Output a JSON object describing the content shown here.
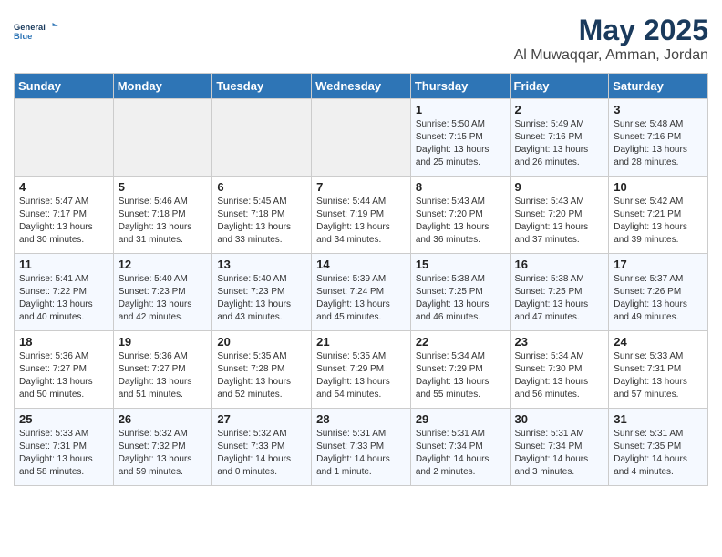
{
  "logo": {
    "line1": "General",
    "line2": "Blue"
  },
  "title": "May 2025",
  "location": "Al Muwaqqar, Amman, Jordan",
  "weekdays": [
    "Sunday",
    "Monday",
    "Tuesday",
    "Wednesday",
    "Thursday",
    "Friday",
    "Saturday"
  ],
  "weeks": [
    [
      {
        "day": "",
        "info": ""
      },
      {
        "day": "",
        "info": ""
      },
      {
        "day": "",
        "info": ""
      },
      {
        "day": "",
        "info": ""
      },
      {
        "day": "1",
        "info": "Sunrise: 5:50 AM\nSunset: 7:15 PM\nDaylight: 13 hours\nand 25 minutes."
      },
      {
        "day": "2",
        "info": "Sunrise: 5:49 AM\nSunset: 7:16 PM\nDaylight: 13 hours\nand 26 minutes."
      },
      {
        "day": "3",
        "info": "Sunrise: 5:48 AM\nSunset: 7:16 PM\nDaylight: 13 hours\nand 28 minutes."
      }
    ],
    [
      {
        "day": "4",
        "info": "Sunrise: 5:47 AM\nSunset: 7:17 PM\nDaylight: 13 hours\nand 30 minutes."
      },
      {
        "day": "5",
        "info": "Sunrise: 5:46 AM\nSunset: 7:18 PM\nDaylight: 13 hours\nand 31 minutes."
      },
      {
        "day": "6",
        "info": "Sunrise: 5:45 AM\nSunset: 7:18 PM\nDaylight: 13 hours\nand 33 minutes."
      },
      {
        "day": "7",
        "info": "Sunrise: 5:44 AM\nSunset: 7:19 PM\nDaylight: 13 hours\nand 34 minutes."
      },
      {
        "day": "8",
        "info": "Sunrise: 5:43 AM\nSunset: 7:20 PM\nDaylight: 13 hours\nand 36 minutes."
      },
      {
        "day": "9",
        "info": "Sunrise: 5:43 AM\nSunset: 7:20 PM\nDaylight: 13 hours\nand 37 minutes."
      },
      {
        "day": "10",
        "info": "Sunrise: 5:42 AM\nSunset: 7:21 PM\nDaylight: 13 hours\nand 39 minutes."
      }
    ],
    [
      {
        "day": "11",
        "info": "Sunrise: 5:41 AM\nSunset: 7:22 PM\nDaylight: 13 hours\nand 40 minutes."
      },
      {
        "day": "12",
        "info": "Sunrise: 5:40 AM\nSunset: 7:23 PM\nDaylight: 13 hours\nand 42 minutes."
      },
      {
        "day": "13",
        "info": "Sunrise: 5:40 AM\nSunset: 7:23 PM\nDaylight: 13 hours\nand 43 minutes."
      },
      {
        "day": "14",
        "info": "Sunrise: 5:39 AM\nSunset: 7:24 PM\nDaylight: 13 hours\nand 45 minutes."
      },
      {
        "day": "15",
        "info": "Sunrise: 5:38 AM\nSunset: 7:25 PM\nDaylight: 13 hours\nand 46 minutes."
      },
      {
        "day": "16",
        "info": "Sunrise: 5:38 AM\nSunset: 7:25 PM\nDaylight: 13 hours\nand 47 minutes."
      },
      {
        "day": "17",
        "info": "Sunrise: 5:37 AM\nSunset: 7:26 PM\nDaylight: 13 hours\nand 49 minutes."
      }
    ],
    [
      {
        "day": "18",
        "info": "Sunrise: 5:36 AM\nSunset: 7:27 PM\nDaylight: 13 hours\nand 50 minutes."
      },
      {
        "day": "19",
        "info": "Sunrise: 5:36 AM\nSunset: 7:27 PM\nDaylight: 13 hours\nand 51 minutes."
      },
      {
        "day": "20",
        "info": "Sunrise: 5:35 AM\nSunset: 7:28 PM\nDaylight: 13 hours\nand 52 minutes."
      },
      {
        "day": "21",
        "info": "Sunrise: 5:35 AM\nSunset: 7:29 PM\nDaylight: 13 hours\nand 54 minutes."
      },
      {
        "day": "22",
        "info": "Sunrise: 5:34 AM\nSunset: 7:29 PM\nDaylight: 13 hours\nand 55 minutes."
      },
      {
        "day": "23",
        "info": "Sunrise: 5:34 AM\nSunset: 7:30 PM\nDaylight: 13 hours\nand 56 minutes."
      },
      {
        "day": "24",
        "info": "Sunrise: 5:33 AM\nSunset: 7:31 PM\nDaylight: 13 hours\nand 57 minutes."
      }
    ],
    [
      {
        "day": "25",
        "info": "Sunrise: 5:33 AM\nSunset: 7:31 PM\nDaylight: 13 hours\nand 58 minutes."
      },
      {
        "day": "26",
        "info": "Sunrise: 5:32 AM\nSunset: 7:32 PM\nDaylight: 13 hours\nand 59 minutes."
      },
      {
        "day": "27",
        "info": "Sunrise: 5:32 AM\nSunset: 7:33 PM\nDaylight: 14 hours\nand 0 minutes."
      },
      {
        "day": "28",
        "info": "Sunrise: 5:31 AM\nSunset: 7:33 PM\nDaylight: 14 hours\nand 1 minute."
      },
      {
        "day": "29",
        "info": "Sunrise: 5:31 AM\nSunset: 7:34 PM\nDaylight: 14 hours\nand 2 minutes."
      },
      {
        "day": "30",
        "info": "Sunrise: 5:31 AM\nSunset: 7:34 PM\nDaylight: 14 hours\nand 3 minutes."
      },
      {
        "day": "31",
        "info": "Sunrise: 5:31 AM\nSunset: 7:35 PM\nDaylight: 14 hours\nand 4 minutes."
      }
    ]
  ]
}
